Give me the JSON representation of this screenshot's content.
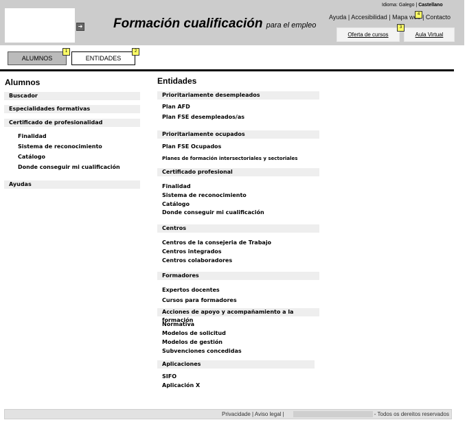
{
  "header": {
    "title": "Formación cualificación",
    "subtitle": "para el empleo",
    "lang_label": "Idioma: Galego |",
    "lang_active": "Castellano",
    "top_links": "Ayuda | Accesibilidad | Mapa web | Contacto",
    "btn_oferta": "Oferta de cursos",
    "btn_aula": "Aula Virtual",
    "badge_3": "3",
    "badge_4": "4"
  },
  "tabs": {
    "alumnos": "ALUMNOS",
    "entidades": "ENTIDADES",
    "badge_1": "1",
    "badge_2": "2"
  },
  "alumnos": {
    "title": "Alumnos",
    "buscador": "Buscador",
    "especialidades": "Especialidades formativas",
    "certificado": "Certificado de profesionalidad",
    "cert_items": [
      "Finalidad",
      "Sistema de reconocimiento",
      "Catálogo",
      "Donde conseguir mi cualificación"
    ],
    "ayudas": "Ayudas"
  },
  "entidades": {
    "title": "Entidades",
    "sections": [
      {
        "head": "Prioritariamente desempleados",
        "items": [
          "Plan AFD",
          "Plan FSE desempleados/as"
        ]
      },
      {
        "head": "Prioritariamente ocupados",
        "items": [
          "Plan FSE Ocupados",
          "Planes de formación intersectoriales y sectoriales"
        ]
      },
      {
        "head": "Certificado profesional",
        "items": [
          "Finalidad",
          "Sistema de reconocimiento",
          "Catálogo",
          "Donde conseguir mi cualificación"
        ]
      },
      {
        "head": "Centros",
        "items": [
          "Centros de la consejeria de Trabajo",
          "Centros integrados",
          "Centros colaboradores"
        ]
      },
      {
        "head": "Formadores",
        "items": [
          "Expertos docentes",
          "Cursos para formadores"
        ]
      },
      {
        "head": "Acciones de apoyo y acompañamiento a la formación",
        "items": [
          "Normativa",
          "Modelos de solicitud",
          "Modelos de gestión",
          "Subvenciones concedidas"
        ]
      },
      {
        "head": "Aplicaciones",
        "items": [
          "SIFO",
          "Aplicación X"
        ]
      }
    ]
  },
  "footer": {
    "links": "Privacidade | Aviso legal |",
    "rights": "- Todos os dereitos reservados"
  }
}
